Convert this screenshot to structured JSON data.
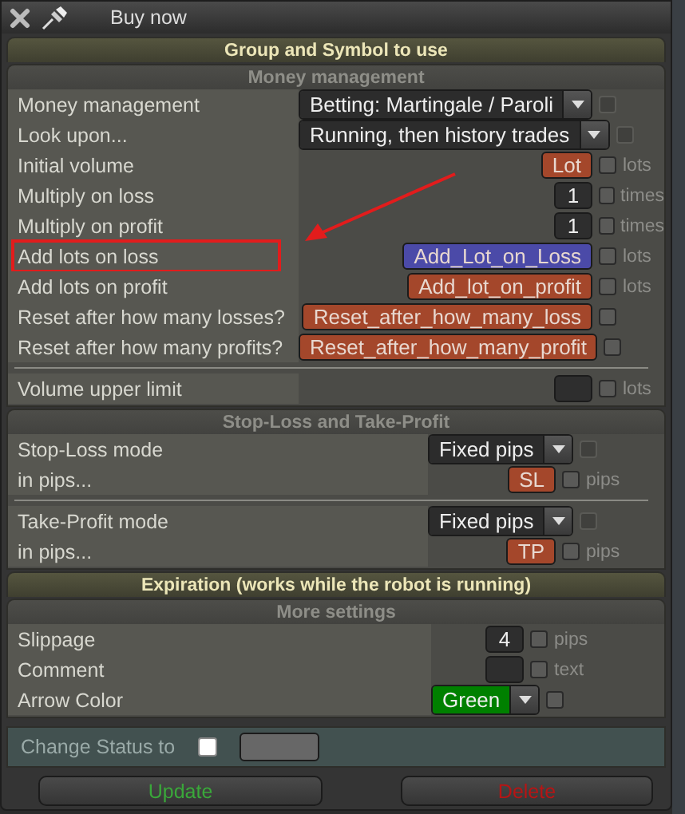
{
  "window": {
    "title": "Buy now"
  },
  "sections": [
    {
      "title": "Group and Symbol to use",
      "expanded": false
    },
    {
      "title": "Money management",
      "expanded": true,
      "groups": [
        {
          "rows": [
            {
              "label": "Money management",
              "kind": "select",
              "value": "Betting: Martingale / Paroli",
              "checked": false,
              "disabled": true,
              "highlighted": false
            },
            {
              "label": "Look upon...",
              "kind": "select",
              "value": "Running, then history trades",
              "checked": false,
              "disabled": true,
              "highlighted": false
            },
            {
              "label": "Initial volume",
              "kind": "tag",
              "value": "Lot",
              "color": "#a4472b",
              "unit": "lots",
              "checked": false,
              "disabled": false,
              "highlighted": false
            },
            {
              "label": "Multiply on loss",
              "kind": "input",
              "value": "1",
              "unit": "times",
              "checked": false,
              "disabled": false,
              "highlighted": false
            },
            {
              "label": "Multiply on profit",
              "kind": "input",
              "value": "1",
              "unit": "times",
              "checked": false,
              "disabled": false,
              "highlighted": false
            },
            {
              "label": "Add lots on loss",
              "kind": "tag",
              "value": "Add_Lot_on_Loss",
              "color": "#4b4aa8",
              "unit": "lots",
              "checked": false,
              "disabled": false,
              "highlighted": true
            },
            {
              "label": "Add lots on profit",
              "kind": "tag",
              "value": "Add_lot_on_profit",
              "color": "#a4472b",
              "unit": "lots",
              "checked": false,
              "disabled": false,
              "highlighted": false
            },
            {
              "label": "Reset after how many losses?",
              "kind": "tag",
              "value": "Reset_after_how_many_loss",
              "color": "#a4472b",
              "checked": false,
              "disabled": false,
              "highlighted": false
            },
            {
              "label": "Reset after how many profits?",
              "kind": "tag",
              "value": "Reset_after_how_many_profit",
              "color": "#a4472b",
              "checked": false,
              "disabled": false,
              "highlighted": false
            }
          ]
        },
        {
          "rows": [
            {
              "label": "Volume upper limit",
              "kind": "input",
              "unit": "lots",
              "checked": false,
              "disabled": false,
              "highlighted": false
            }
          ]
        }
      ]
    },
    {
      "title": "Stop-Loss and Take-Profit",
      "expanded": true,
      "groups": [
        {
          "rows": [
            {
              "label": "Stop-Loss mode",
              "kind": "select",
              "value": "Fixed pips",
              "checked": false,
              "disabled": true,
              "highlighted": false
            },
            {
              "label": "in pips...",
              "kind": "tag",
              "value": "SL",
              "color": "#a4472b",
              "unit": "pips",
              "checked": false,
              "disabled": false,
              "highlighted": false
            }
          ]
        },
        {
          "rows": [
            {
              "label": "Take-Profit mode",
              "kind": "select",
              "value": "Fixed pips",
              "checked": false,
              "disabled": true,
              "highlighted": false
            },
            {
              "label": "in pips...",
              "kind": "tag",
              "value": "TP",
              "color": "#a4472b",
              "unit": "pips",
              "checked": false,
              "disabled": false,
              "highlighted": false
            }
          ]
        }
      ]
    },
    {
      "title": "Expiration (works while the robot is running)",
      "expanded": false
    },
    {
      "title": "More settings",
      "expanded": true,
      "groups": [
        {
          "rows": [
            {
              "label": "Slippage",
              "kind": "input",
              "value": "4",
              "unit": "pips",
              "checked": false,
              "disabled": false,
              "highlighted": false
            },
            {
              "label": "Comment",
              "kind": "input",
              "unit": "text",
              "checked": false,
              "disabled": false,
              "highlighted": false
            },
            {
              "label": "Arrow Color",
              "kind": "select",
              "value": "Green",
              "color": "#008000",
              "checked": false,
              "disabled": false,
              "highlighted": false
            }
          ]
        }
      ]
    }
  ],
  "status": {
    "label": "Change Status to",
    "checked": false
  },
  "buttons": [
    {
      "label": "Update",
      "color": "#3aa83a"
    },
    {
      "label": "Delete",
      "color": "#b81414"
    }
  ]
}
